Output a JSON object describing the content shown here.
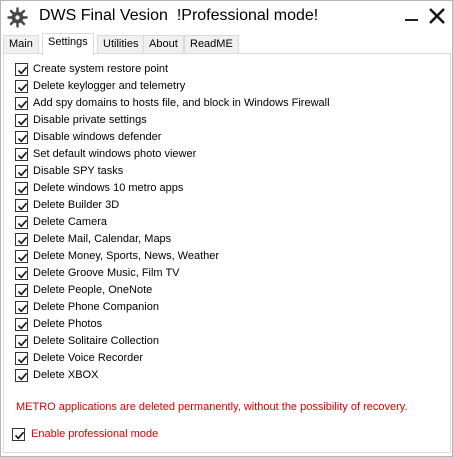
{
  "window": {
    "title": "DWS Final Vesion  !Professional mode!"
  },
  "tabs": [
    {
      "label": "Main",
      "active": false
    },
    {
      "label": "Settings",
      "active": true
    },
    {
      "label": "Utilities",
      "active": false
    },
    {
      "label": "About",
      "active": false
    },
    {
      "label": "ReadME",
      "active": false
    }
  ],
  "settings": {
    "options": [
      {
        "label": "Create system restore point",
        "checked": true
      },
      {
        "label": "Delete keylogger and telemetry",
        "checked": true
      },
      {
        "label": "Add spy domains to hosts file, and block in Windows Firewall",
        "checked": true
      },
      {
        "label": "Disable private settings",
        "checked": true
      },
      {
        "label": "Disable windows defender",
        "checked": true
      },
      {
        "label": "Set default windows photo viewer",
        "checked": true
      },
      {
        "label": "Disable SPY tasks",
        "checked": true
      },
      {
        "label": "Delete windows 10 metro apps",
        "checked": true
      },
      {
        "label": "Delete Builder 3D",
        "checked": true
      },
      {
        "label": "Delete Camera",
        "checked": true
      },
      {
        "label": "Delete Mail, Calendar, Maps",
        "checked": true
      },
      {
        "label": "Delete Money, Sports, News, Weather",
        "checked": true
      },
      {
        "label": "Delete Groove Music, Film TV",
        "checked": true
      },
      {
        "label": "Delete People, OneNote",
        "checked": true
      },
      {
        "label": "Delete Phone Companion",
        "checked": true
      },
      {
        "label": "Delete Photos",
        "checked": true
      },
      {
        "label": "Delete Solitaire Collection",
        "checked": true
      },
      {
        "label": "Delete Voice Recorder",
        "checked": true
      },
      {
        "label": "Delete XBOX",
        "checked": true
      }
    ],
    "warning": "METRO applications are deleted permanently, without the possibility of recovery.",
    "professional_mode": {
      "label": "Enable professional mode",
      "checked": true
    }
  },
  "colors": {
    "warning": "#d40000",
    "border": "#d9d9d9"
  },
  "icons": {
    "app": "dws-app-icon",
    "minimize": "minimize-icon",
    "close": "close-icon",
    "check": "checkmark-icon"
  }
}
